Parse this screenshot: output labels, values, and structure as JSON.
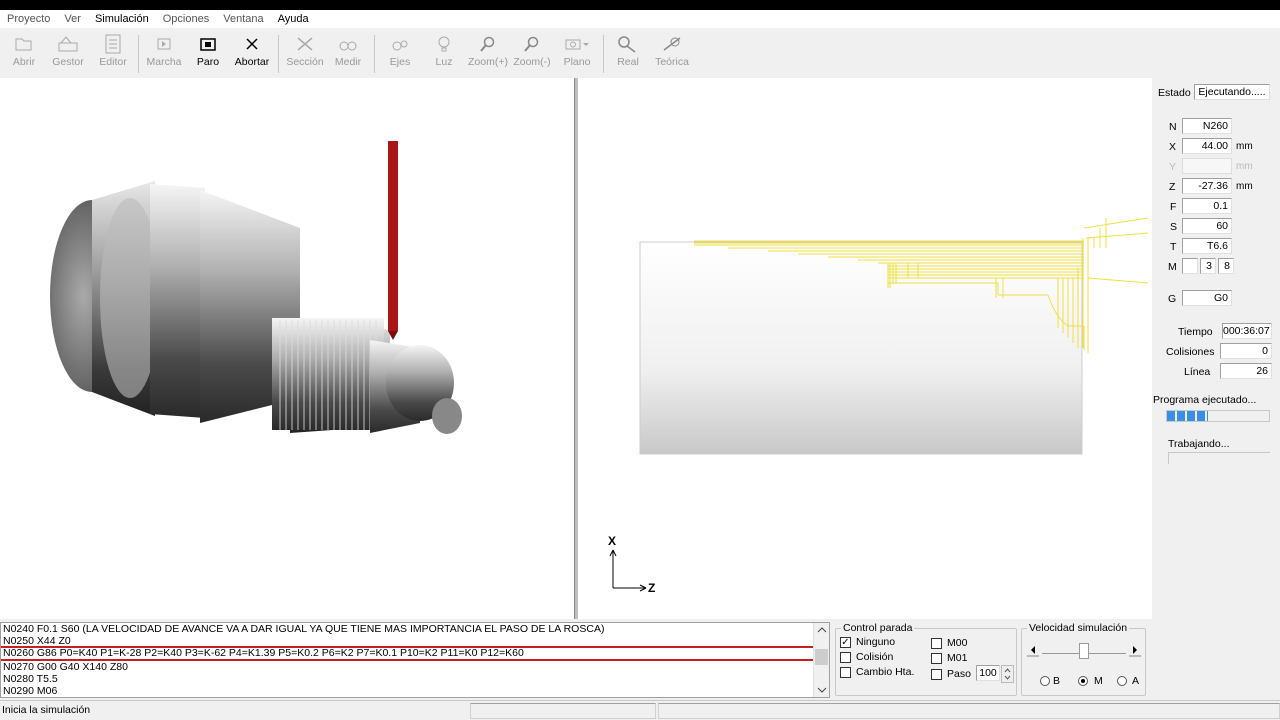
{
  "menu": [
    "Proyecto",
    "Ver",
    "Simulación",
    "Opciones",
    "Ventana",
    "Ayuda"
  ],
  "toolbar": {
    "abrir": "Abrir",
    "gestor": "Gestor",
    "editor": "Editor",
    "marcha": "Marcha",
    "paro": "Paro",
    "abortar": "Abortar",
    "seccion": "Sección",
    "medir": "Medir",
    "ejes": "Ejes",
    "luz": "Luz",
    "zoom_in": "Zoom(+)",
    "zoom_out": "Zoom(-)",
    "plano": "Plano",
    "real": "Real",
    "teorica": "Teórica"
  },
  "status_panel": {
    "estado_label": "Estado",
    "estado_value": "Ejecutando.....",
    "n_label": "N",
    "n_value": "N260",
    "x_label": "X",
    "x_value": "44.00",
    "x_unit": "mm",
    "y_label": "Y",
    "y_value": "",
    "y_unit": "mm",
    "z_label": "Z",
    "z_value": "-27.36",
    "z_unit": "mm",
    "f_label": "F",
    "f_value": "0.1",
    "s_label": "S",
    "s_value": "60",
    "t_label": "T",
    "t_value": "T6.6",
    "m_label": "M",
    "m_value1": "3",
    "m_value2": "8",
    "g_label": "G",
    "g_value": "G0",
    "tiempo_label": "Tiempo",
    "tiempo_value": "000:36:07",
    "colisiones_label": "Colisiones",
    "colisiones_value": "0",
    "linea_label": "Línea",
    "linea_value": "26",
    "programa_label": "Programa ejecutado...",
    "programa_progress": 0.4,
    "trabajando_label": "Trabajando..."
  },
  "axes": {
    "x": "X",
    "z": "Z"
  },
  "code_lines": [
    "N0240 F0.1 S60 (LA VELOCIDAD DE AVANCE VA A DAR IGUAL YA QUE TIENE MAS IMPORTANCIA EL PASO DE LA ROSCA)",
    "N0250 X44 Z0",
    "N0260 G86 P0=K40 P1=K-28 P2=K40 P3=K-62 P4=K1.39 P5=K0.2 P6=K2 P7=K0.1 P10=K2 P11=K0 P12=K60",
    "N0270 G00 G40 X140 Z80",
    "N0280 T5.5",
    "N0290 M06"
  ],
  "control_parada": {
    "title": "Control parada",
    "ninguno": "Ninguno",
    "colision": "Colisión",
    "cambio": "Cambio Hta.",
    "m00": "M00",
    "m01": "M01",
    "paso": "Paso",
    "paso_value": "100"
  },
  "velocidad": {
    "title": "Velocidad simulación",
    "b": "B",
    "m": "M",
    "a": "A"
  },
  "statusbar": {
    "text": "Inicia la simulación"
  }
}
